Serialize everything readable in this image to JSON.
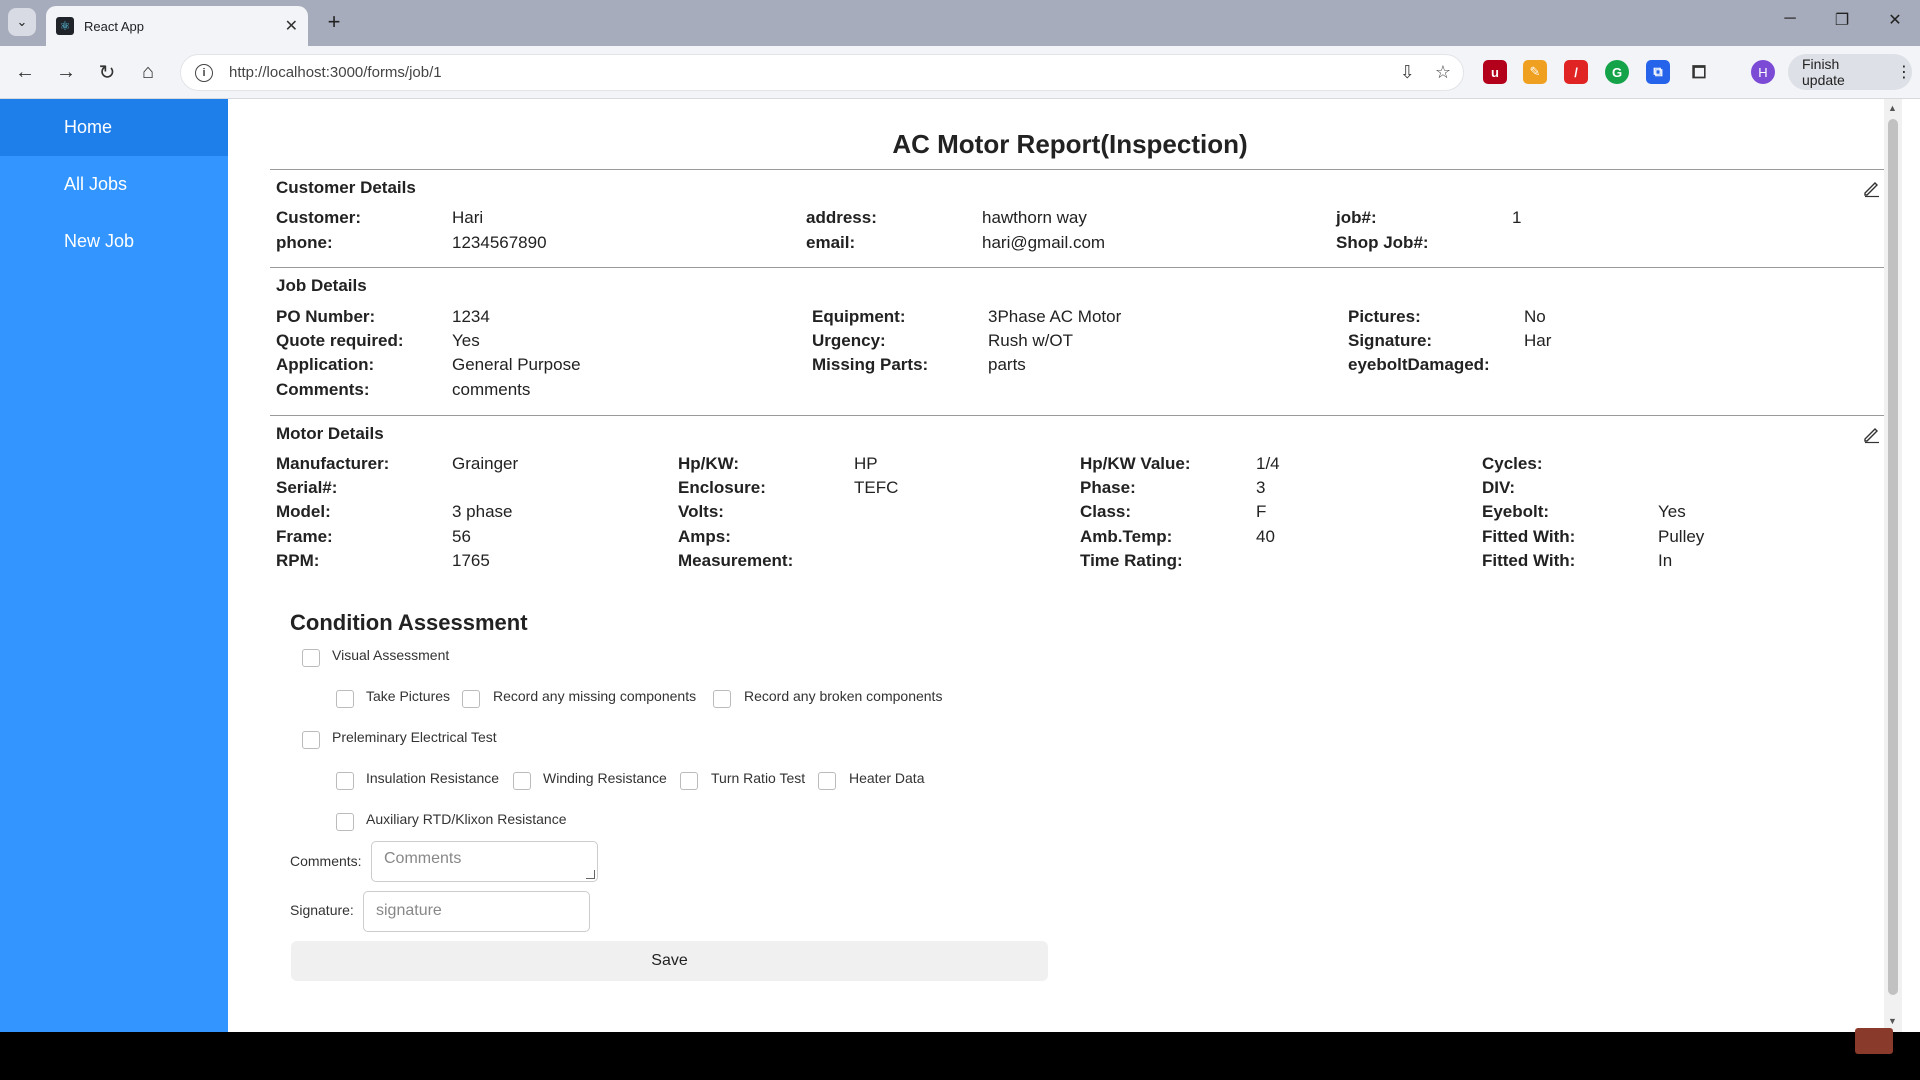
{
  "browser": {
    "tab_title": "React App",
    "url": "http://localhost:3000/forms/job/1",
    "update_label": "Finish update",
    "profile_initial": "H"
  },
  "sidebar": {
    "items": [
      {
        "label": "Home"
      },
      {
        "label": "All Jobs"
      },
      {
        "label": "New Job"
      }
    ]
  },
  "report": {
    "title": "AC Motor Report(Inspection)",
    "customer": {
      "title": "Customer Details",
      "customer_label": "Customer:",
      "customer_value": "Hari",
      "phone_label": "phone:",
      "phone_value": "1234567890",
      "address_label": "address:",
      "address_value": "hawthorn way",
      "email_label": "email:",
      "email_value": "hari@gmail.com",
      "job_label": "job#:",
      "job_value": "1",
      "shopjob_label": "Shop Job#:",
      "shopjob_value": ""
    },
    "job": {
      "title": "Job Details",
      "po_label": "PO Number:",
      "po_value": "1234",
      "quote_label": "Quote required:",
      "quote_value": "Yes",
      "application_label": "Application:",
      "application_value": "General Purpose",
      "comments_label": "Comments:",
      "comments_value": "comments",
      "equipment_label": "Equipment:",
      "equipment_value": "3Phase AC Motor",
      "urgency_label": "Urgency:",
      "urgency_value": "Rush w/OT",
      "missing_label": "Missing Parts:",
      "missing_value": "parts",
      "pictures_label": "Pictures:",
      "pictures_value": "No",
      "signature_label": "Signature:",
      "signature_value": "Har",
      "eyebolt_label": "eyeboltDamaged:",
      "eyebolt_value": ""
    },
    "motor": {
      "title": "Motor Details",
      "col1": [
        {
          "label": "Manufacturer:",
          "value": "Grainger"
        },
        {
          "label": "Serial#:",
          "value": ""
        },
        {
          "label": "Model:",
          "value": "3 phase"
        },
        {
          "label": "Frame:",
          "value": "56"
        },
        {
          "label": "RPM:",
          "value": "1765"
        }
      ],
      "col2": [
        {
          "label": "Hp/KW:",
          "value": "HP"
        },
        {
          "label": "Enclosure:",
          "value": "TEFC"
        },
        {
          "label": "Volts:",
          "value": ""
        },
        {
          "label": "Amps:",
          "value": ""
        },
        {
          "label": "Measurement:",
          "value": ""
        }
      ],
      "col3": [
        {
          "label": "Hp/KW Value:",
          "value": "1/4"
        },
        {
          "label": "Phase:",
          "value": "3"
        },
        {
          "label": "Class:",
          "value": "F"
        },
        {
          "label": "Amb.Temp:",
          "value": "40"
        },
        {
          "label": "Time Rating:",
          "value": ""
        }
      ],
      "col4": [
        {
          "label": "Cycles:",
          "value": ""
        },
        {
          "label": "DIV:",
          "value": ""
        },
        {
          "label": "Eyebolt:",
          "value": "Yes"
        },
        {
          "label": "Fitted With:",
          "value": "Pulley"
        },
        {
          "label": "Fitted With:",
          "value": "In"
        }
      ]
    }
  },
  "assessment": {
    "title": "Condition Assessment",
    "visual": "Visual Assessment",
    "take_pictures": "Take Pictures",
    "missing_components": "Record any missing components",
    "broken_components": "Record any broken components",
    "electrical": "Preleminary Electrical Test",
    "insulation": "Insulation Resistance",
    "winding": "Winding Resistance",
    "turn_ratio": "Turn Ratio Test",
    "heater": "Heater Data",
    "auxiliary": "Auxiliary RTD/Klixon Resistance",
    "comments_label": "Comments:",
    "comments_placeholder": "Comments",
    "signature_label": "Signature:",
    "signature_placeholder": "signature",
    "save_label": "Save"
  }
}
